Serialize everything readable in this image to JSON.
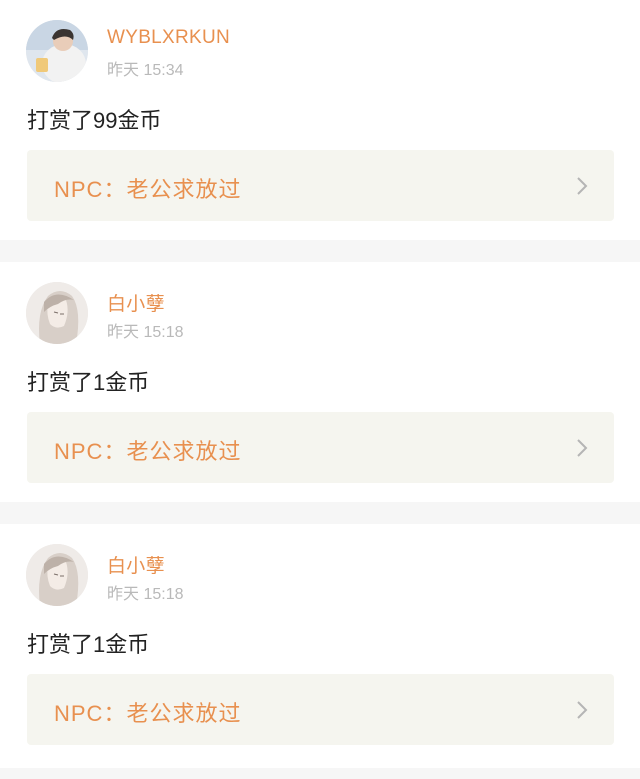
{
  "posts": [
    {
      "username": "WYBLXRKUN",
      "timestamp": "昨天 15:34",
      "action": "打赏了99金币",
      "npc_text": "NPC：老公求放过",
      "avatar": "photo-avatar"
    },
    {
      "username": "白小孽",
      "timestamp": "昨天 15:18",
      "action": "打赏了1金币",
      "npc_text": "NPC：老公求放过",
      "avatar": "illustrated-avatar"
    },
    {
      "username": "白小孽",
      "timestamp": "昨天 15:18",
      "action": "打赏了1金币",
      "npc_text": "NPC：老公求放过",
      "avatar": "illustrated-avatar"
    }
  ],
  "icons": {
    "chevron": "chevron-right-icon"
  },
  "colors": {
    "accent": "#e8904f",
    "muted": "#b9b9b9",
    "text": "#222222",
    "link_bg": "#f5f5ef",
    "divider": "#f6f6f6"
  }
}
